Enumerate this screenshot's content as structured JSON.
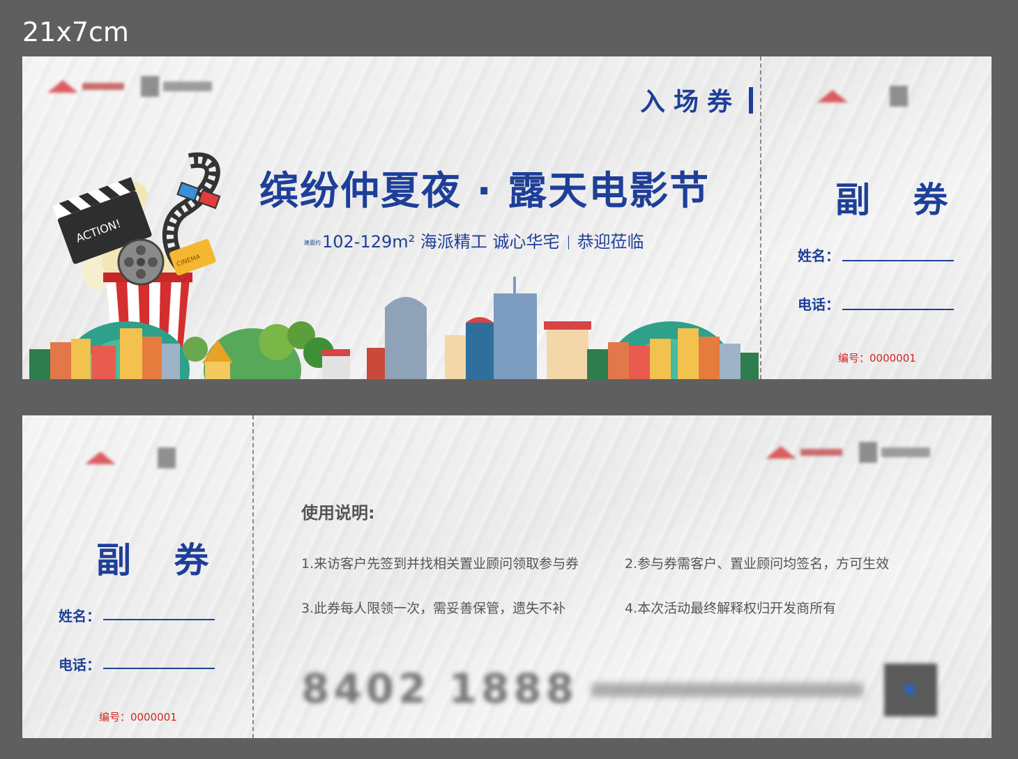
{
  "size_label": "21x7cm",
  "front": {
    "entry_title": "入场券",
    "main_title": "缤纷仲夏夜 · 露天电影节",
    "subline": {
      "tiny": "建面约",
      "area": "102-129m²",
      "slogan": "海派精工 诚心华宅",
      "welcome": "恭迎莅临"
    },
    "props": {
      "clapper_text": "ACTION!",
      "ticket_text": "CINEMA"
    },
    "stub": {
      "title": "副 券",
      "name_label": "姓名：",
      "phone_label": "电话：",
      "serial": "编号：0000001"
    }
  },
  "back": {
    "stub": {
      "title": "副 券",
      "name_label": "姓名：",
      "phone_label": "电话：",
      "serial": "编号：0000001"
    },
    "instructions": {
      "title": "使用说明:",
      "items": [
        "1.来访客户先签到并找相关置业顾问领取参与券",
        "2.参与券需客户、置业顾问均签名，方可生效",
        "3.此券每人限领一次，需妥善保管，遗失不补",
        "4.本次活动最终解释权归开发商所有"
      ]
    },
    "phone_blurred": "8402 1888"
  },
  "colors": {
    "brand_blue": "#1e3f98",
    "serial_red": "#d22424",
    "background": "#5f5f5f"
  }
}
